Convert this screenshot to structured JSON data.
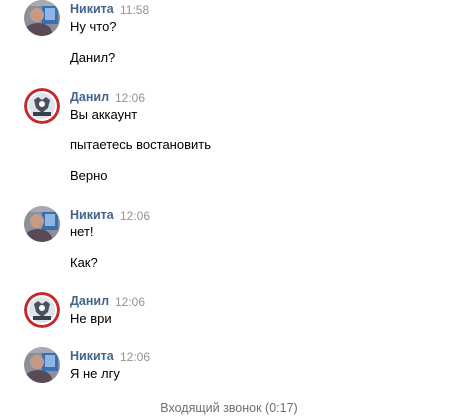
{
  "messages": [
    {
      "author": "Никита",
      "time": "11:58",
      "avatar": "user-nikita-photo-avatar",
      "lines": [
        "Ну что?",
        "Данил?"
      ]
    },
    {
      "author": "Данил",
      "time": "12:06",
      "avatar": "user-danil-emblem-avatar",
      "lines": [
        "Вы аккаунт",
        "пытаетесь востановить",
        "Верно"
      ]
    },
    {
      "author": "Никита",
      "time": "12:06",
      "avatar": "user-nikita-photo-avatar",
      "lines": [
        "нет!",
        "Как?"
      ]
    },
    {
      "author": "Данил",
      "time": "12:06",
      "avatar": "user-danil-emblem-avatar",
      "lines": [
        "Не ври"
      ]
    },
    {
      "author": "Никита",
      "time": "12:06",
      "avatar": "user-nikita-photo-avatar",
      "lines": [
        "Я не лгу"
      ]
    }
  ],
  "service_message": "Входящий звонок (0:17)",
  "colors": {
    "author": "#42648b",
    "time": "#939393",
    "text": "#000000",
    "service": "#6f6f6f"
  }
}
